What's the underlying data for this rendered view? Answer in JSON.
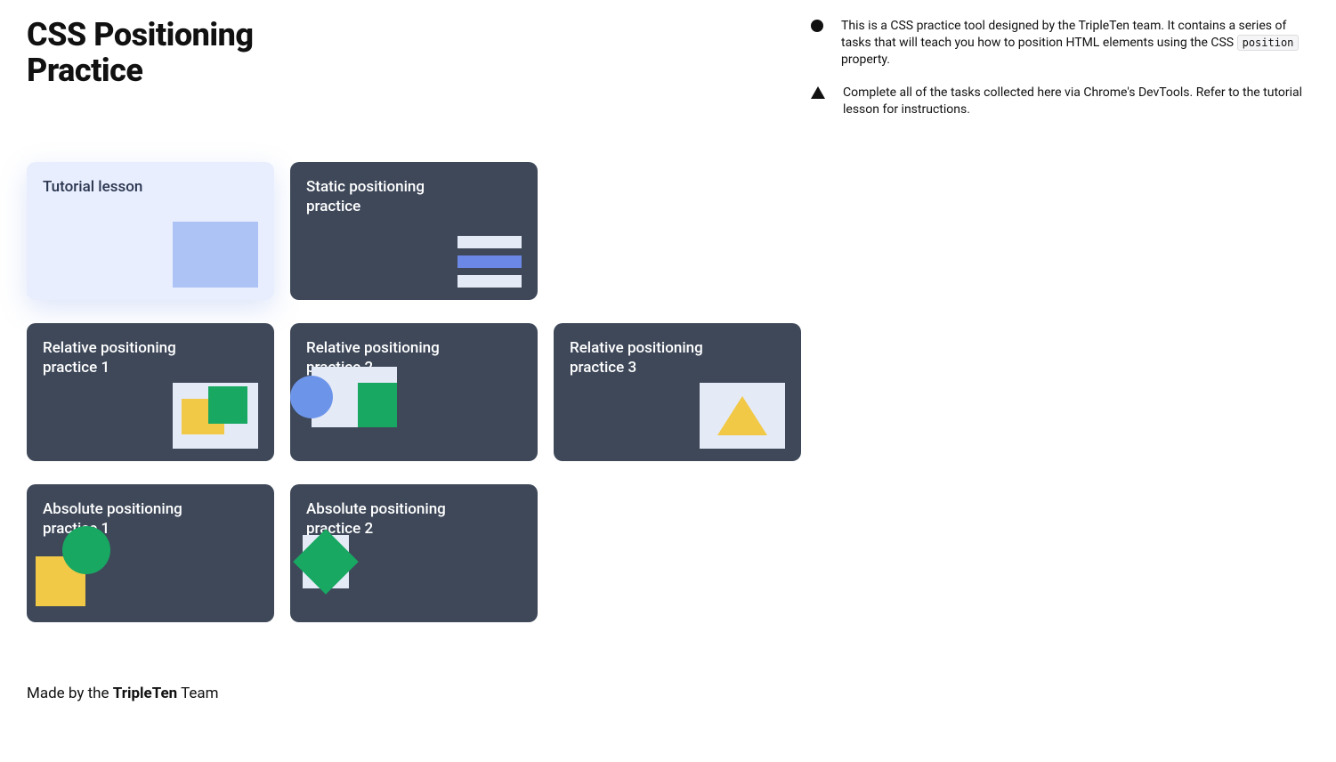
{
  "header": {
    "title": "CSS Positioning Practice"
  },
  "notes": {
    "note1_prefix": "This is a CSS practice tool designed by the TripleTen team. It contains a series of tasks that will teach you how to position HTML elements using the CSS ",
    "note1_code": "position",
    "note1_suffix": " property.",
    "note2": "Complete all of the tasks collected here via Chrome's DevTools. Refer to the tutorial lesson for instructions."
  },
  "cards": {
    "tutorial": "Tutorial lesson",
    "static": "Static positioning practice",
    "rel1": "Relative positioning practice 1",
    "rel2": "Relative positioning practice 2",
    "rel3": "Relative positioning practice 3",
    "abs1": "Absolute positioning practice 1",
    "abs2": "Absolute positioning practice 2"
  },
  "footer": {
    "prefix": "Made by the ",
    "brand": "TripleTen",
    "suffix": " Team"
  },
  "colors": {
    "card_dark": "#3e4859",
    "card_light": "#e8eefd",
    "accent_blue": "#6c95ea",
    "accent_green": "#18a862",
    "accent_yellow": "#f1c946",
    "panel_light": "#e5eaf7",
    "bar_blue": "#6c88e6"
  }
}
